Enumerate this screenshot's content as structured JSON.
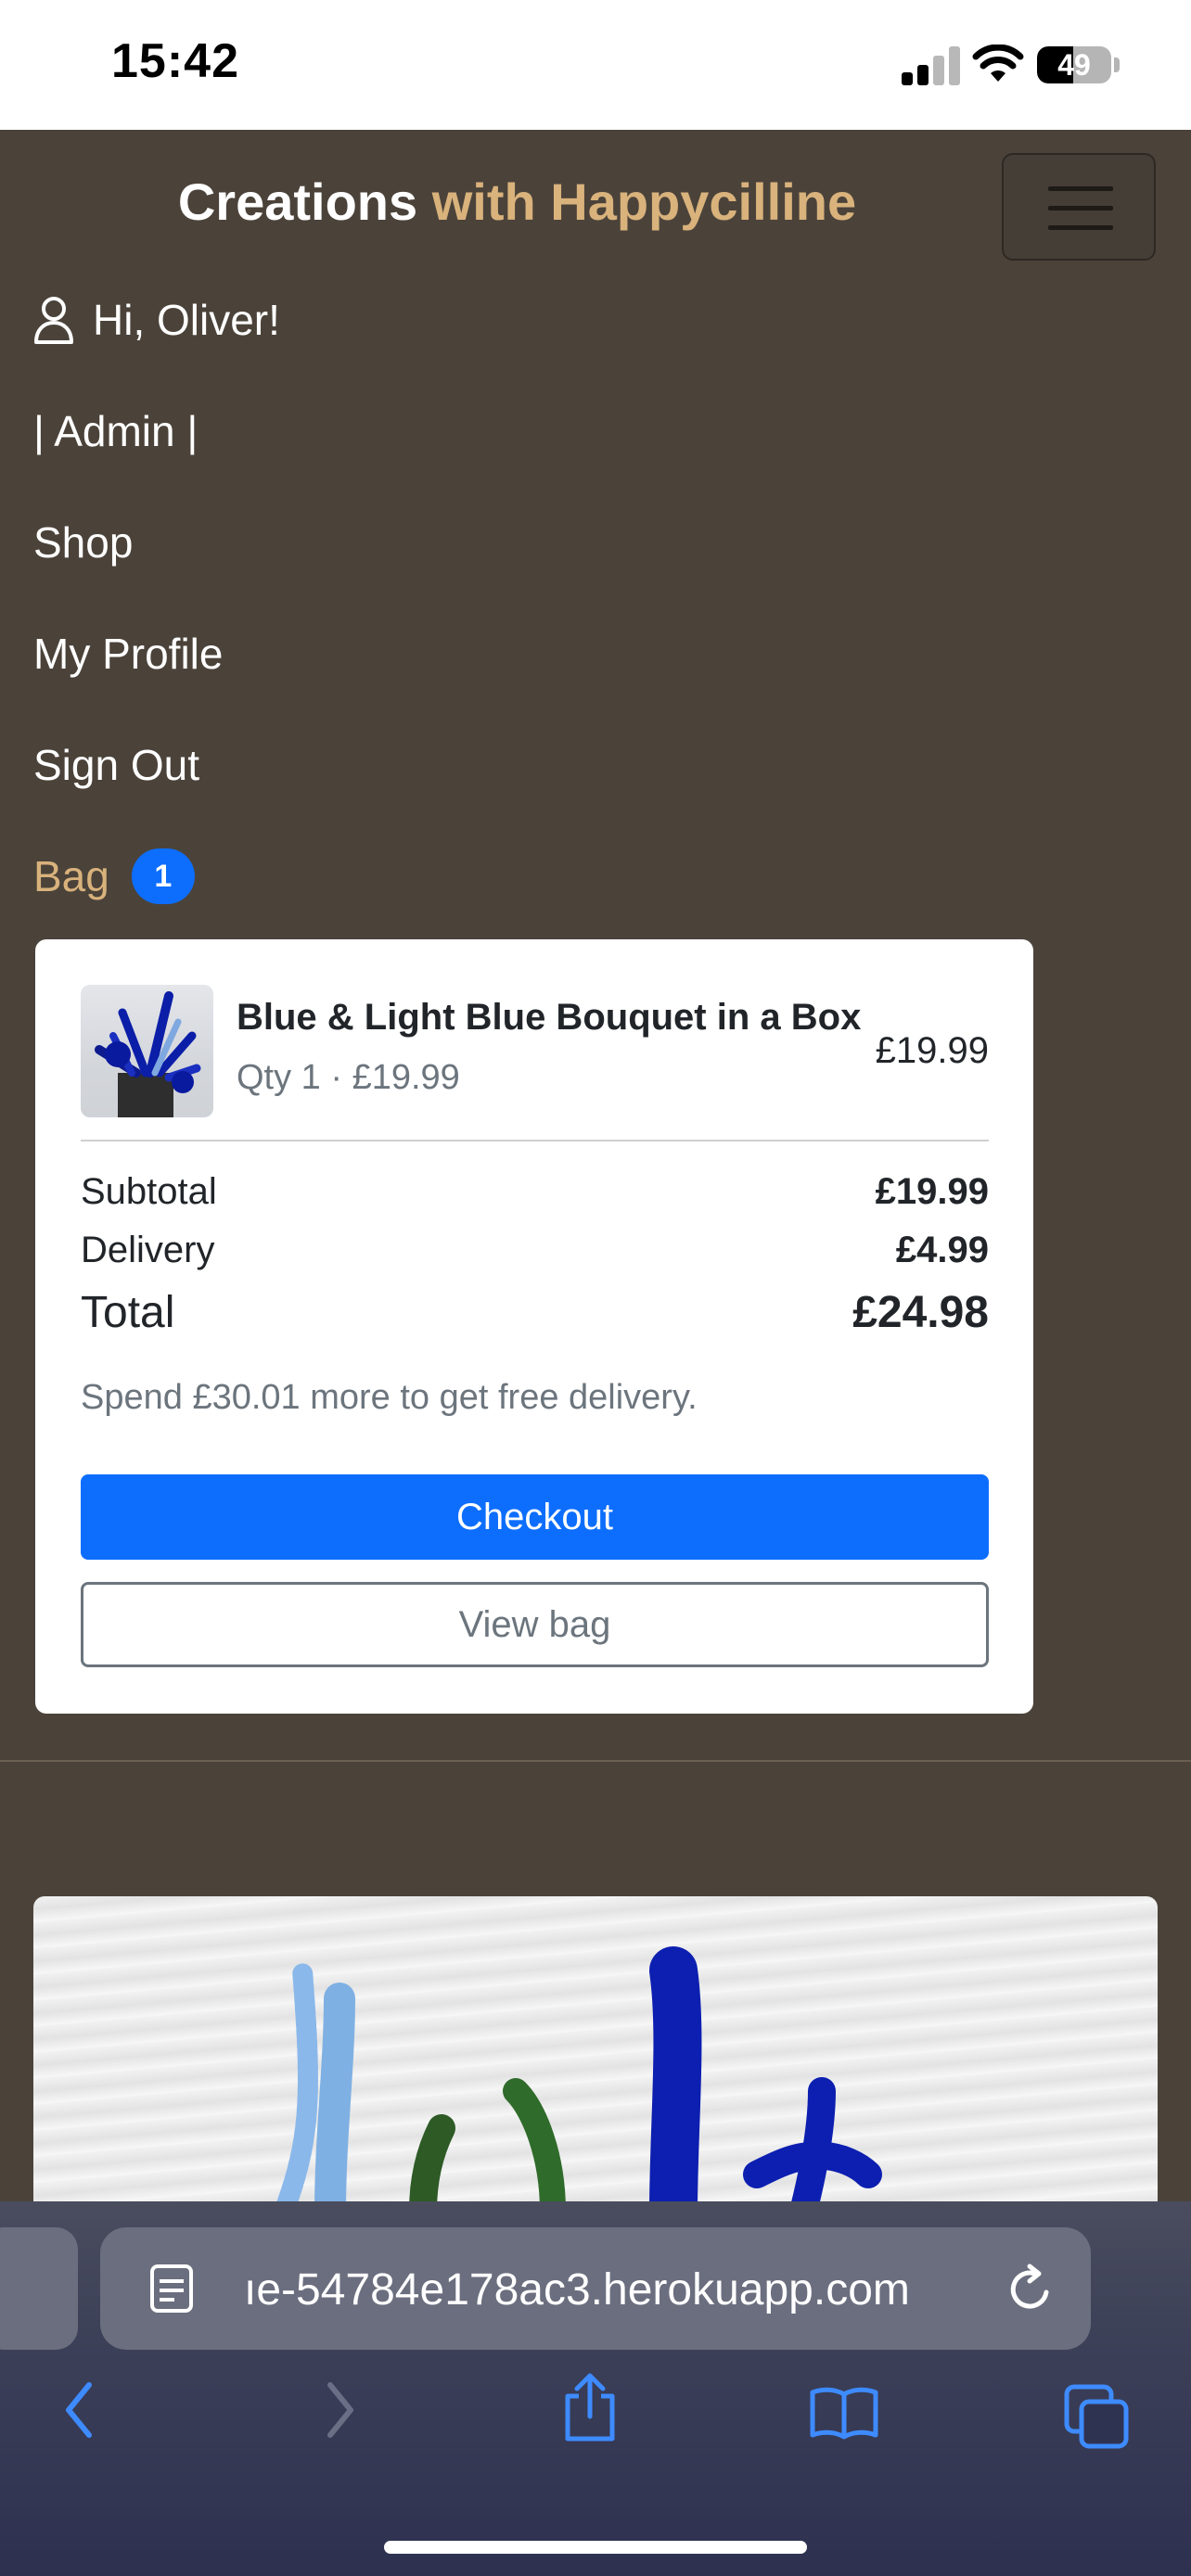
{
  "status_bar": {
    "time": "15:42",
    "battery": "49",
    "battery_level": 0.49
  },
  "header": {
    "brand_main": "Creations",
    "brand_accent": "with Happycilline",
    "accent_color": "#d9b27c"
  },
  "nav": {
    "greeting": "Hi, Oliver!",
    "admin": "| Admin |",
    "shop": "Shop",
    "profile": "My Profile",
    "sign_out": "Sign Out",
    "bag_label": "Bag",
    "bag_count": "1"
  },
  "bag": {
    "item": {
      "name": "Blue & Light Blue Bouquet in a Box",
      "qty_line": "Qty 1 · £19.99",
      "price": "£19.99"
    },
    "subtotal_label": "Subtotal",
    "subtotal": "£19.99",
    "delivery_label": "Delivery",
    "delivery": "£4.99",
    "total_label": "Total",
    "total": "£24.98",
    "free_delivery_note": "Spend £30.01 more to get free delivery.",
    "checkout_label": "Checkout",
    "view_bag_label": "View bag",
    "primary_color": "#0d6efd"
  },
  "browser": {
    "url": "ıe-54784e178ac3.herokuapp.com"
  },
  "icons": {
    "user": "user-icon",
    "menu": "hamburger-menu-icon",
    "reader": "reader-mode-icon",
    "reload": "reload-icon",
    "back": "back-chevron-icon",
    "forward": "forward-chevron-icon",
    "share": "share-icon",
    "bookmarks": "bookmarks-icon",
    "tabs": "tabs-icon"
  }
}
